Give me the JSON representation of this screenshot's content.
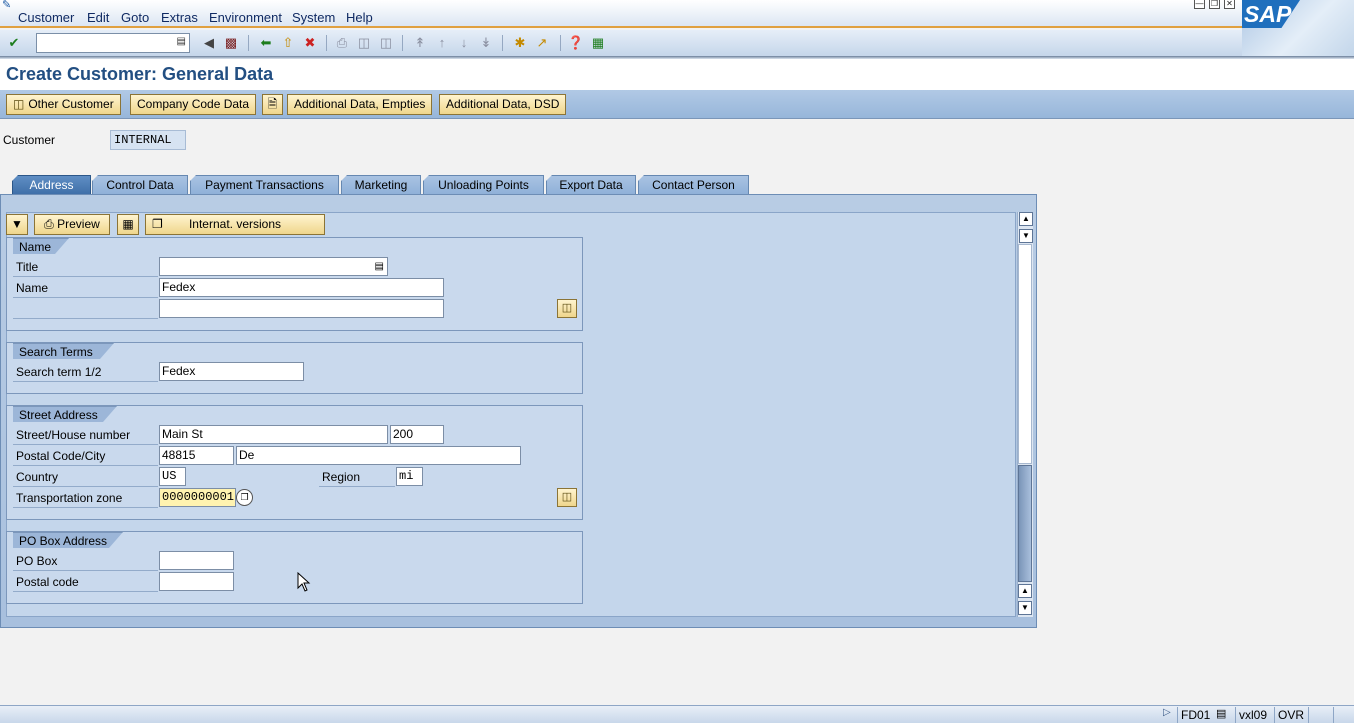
{
  "menu": [
    "Customer",
    "Edit",
    "Goto",
    "Extras",
    "Environment",
    "System",
    "Help"
  ],
  "sap_logo_text": "SAP",
  "command_field": {
    "value": ""
  },
  "page_title": "Create Customer: General Data",
  "app_toolbar": {
    "other_customer": "Other Customer",
    "company_code_data": "Company Code Data",
    "additional_data_empties": "Additional Data, Empties",
    "additional_data_dsd": "Additional Data, DSD"
  },
  "customer": {
    "label": "Customer",
    "value": "INTERNAL"
  },
  "tabs": [
    "Address",
    "Control Data",
    "Payment Transactions",
    "Marketing",
    "Unloading Points",
    "Export Data",
    "Contact Person"
  ],
  "inner_toolbar": {
    "preview": "Preview",
    "internat_versions": "Internat. versions"
  },
  "groups": {
    "name": {
      "title": "Name",
      "title_label": "Title",
      "title_value": "",
      "name_label": "Name",
      "name_value": "Fedex",
      "name2_value": ""
    },
    "search_terms": {
      "title": "Search Terms",
      "label": "Search term 1/2",
      "value": "Fedex"
    },
    "street_address": {
      "title": "Street Address",
      "street_label": "Street/House number",
      "street_value": "Main St",
      "house_number": "200",
      "postal_label": "Postal Code/City",
      "postal_value": "48815",
      "city_value": "De",
      "country_label": "Country",
      "country_value": "US",
      "region_label": "Region",
      "region_value": "mi",
      "transport_label": "Transportation zone",
      "transport_value": "0000000001"
    },
    "po_box": {
      "title": "PO Box Address",
      "po_label": "PO Box",
      "po_value": "",
      "postal_label": "Postal code",
      "postal_value": ""
    }
  },
  "status_bar": {
    "transaction": "FD01",
    "server": "vxl09",
    "mode": "OVR"
  }
}
